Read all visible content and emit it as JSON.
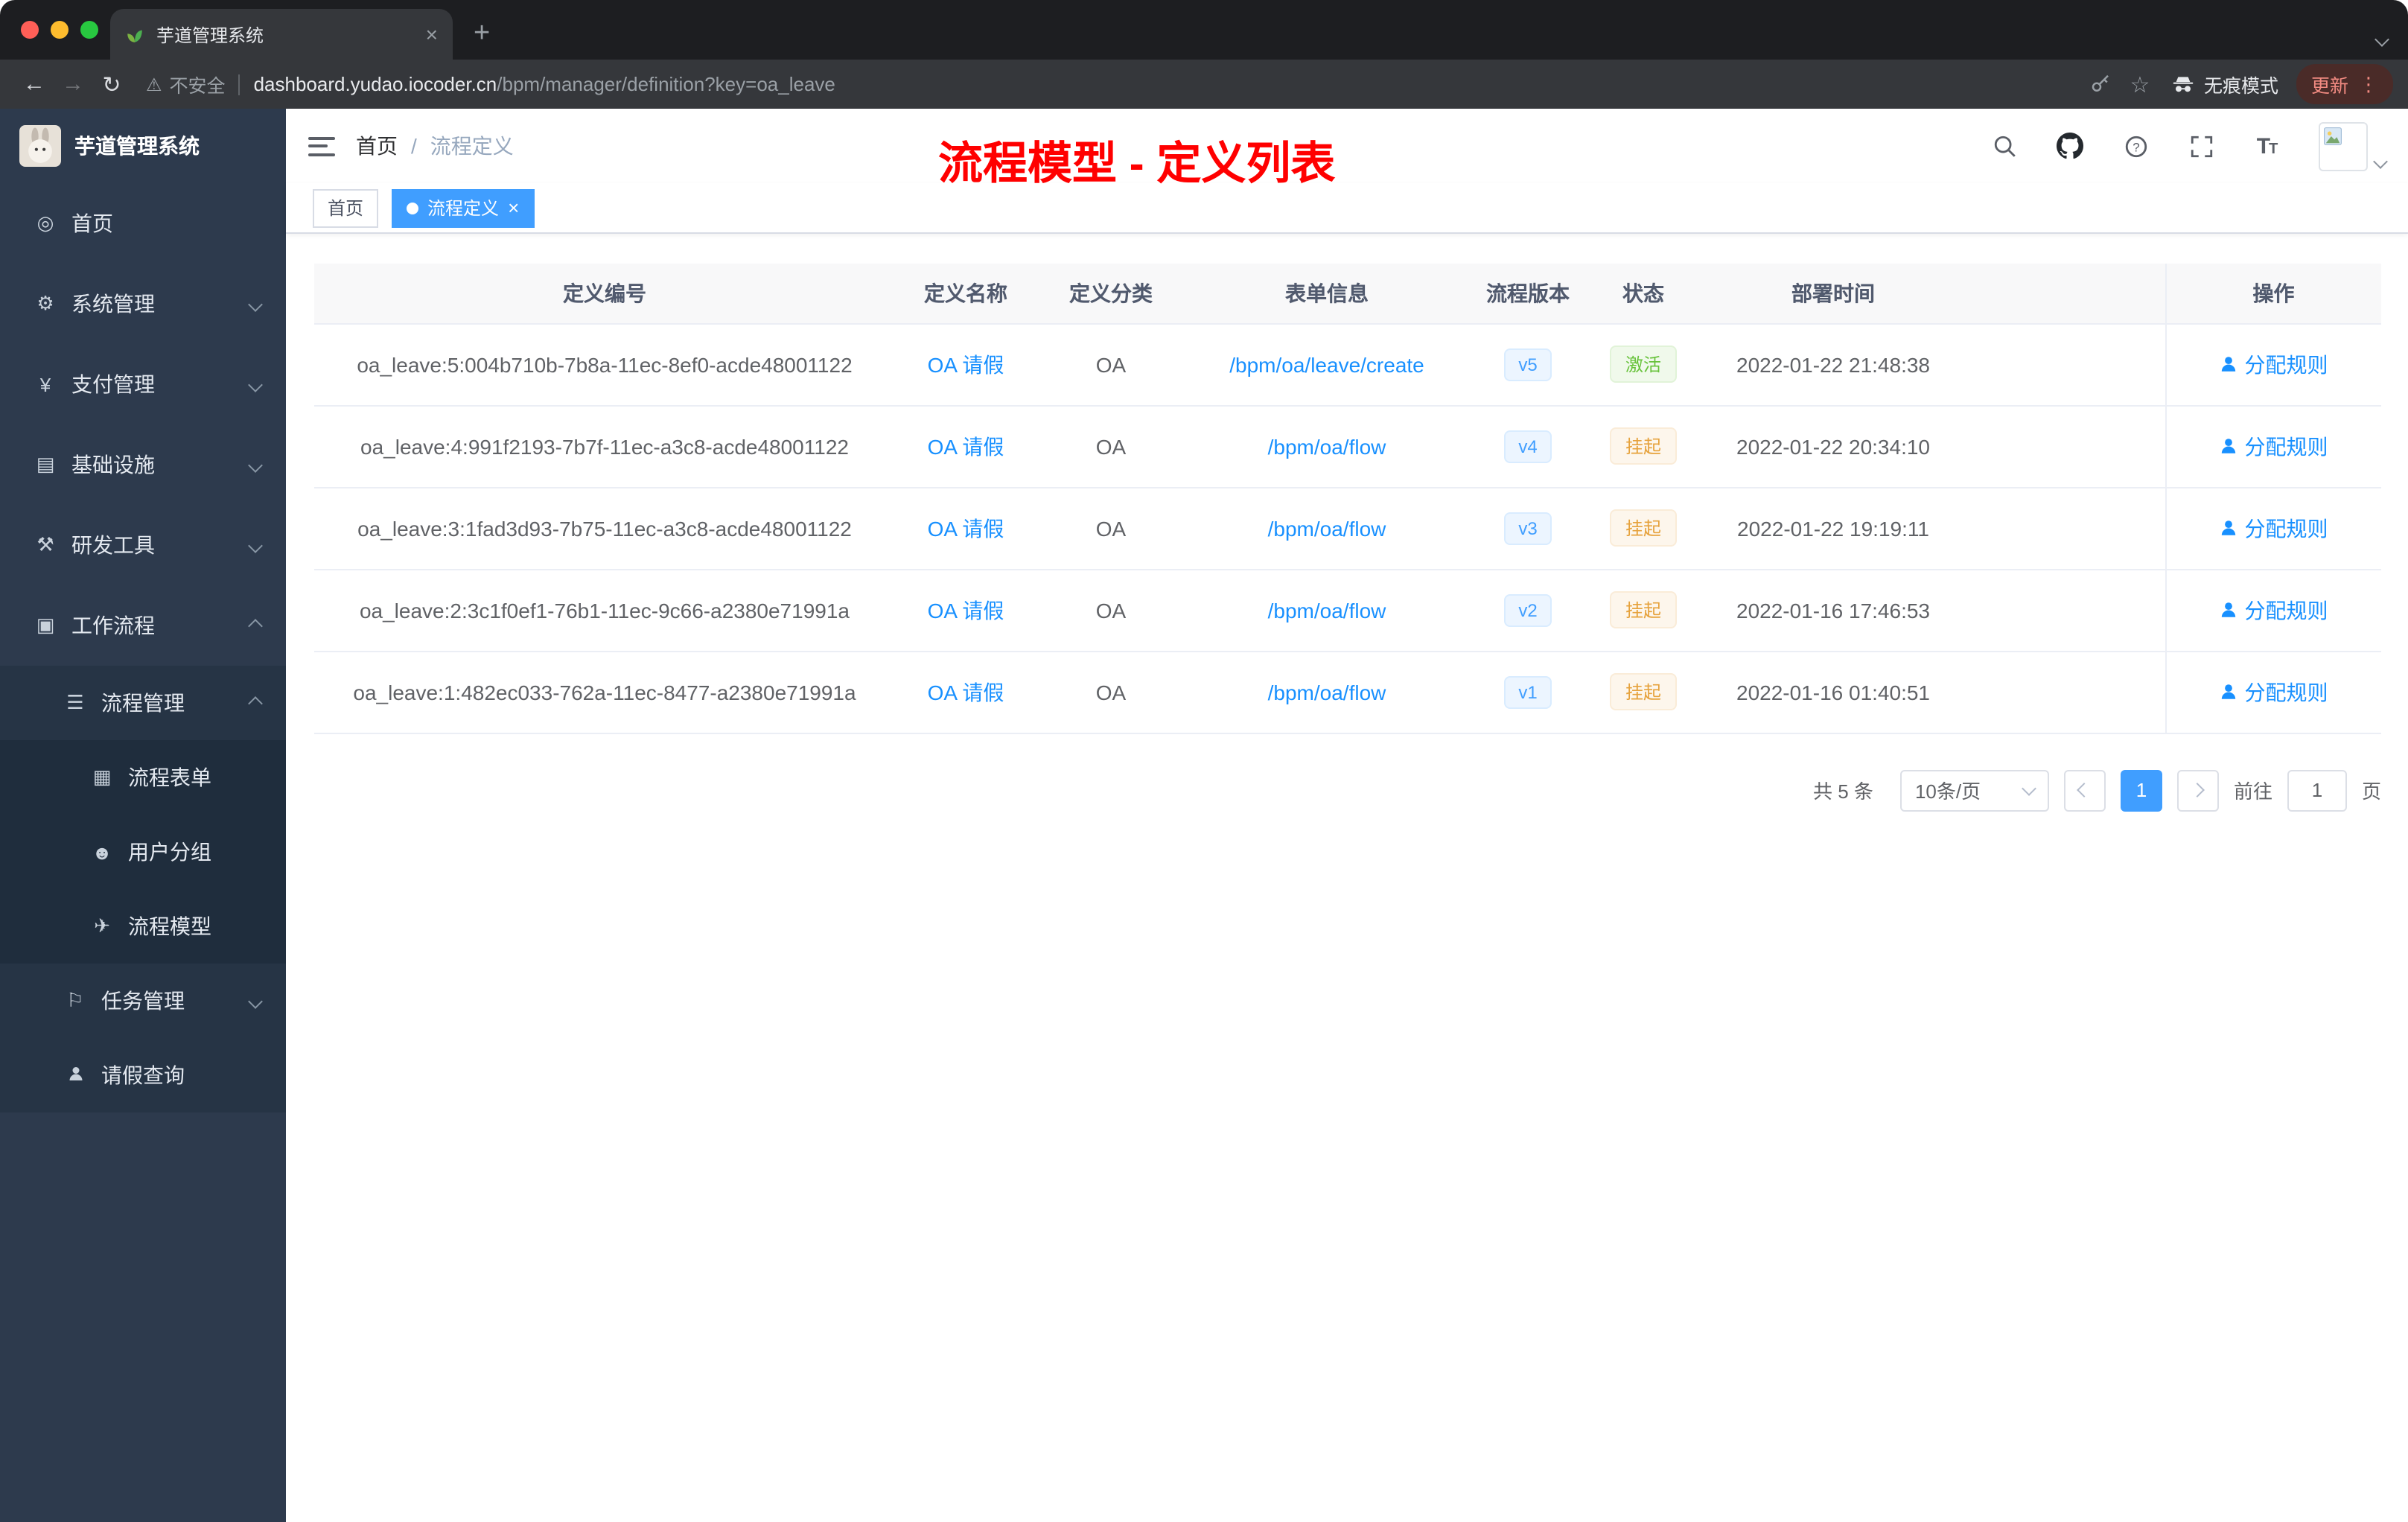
{
  "colors": {
    "accent": "#409eff",
    "link": "#1890ff",
    "success": "#67c23a",
    "warning": "#e6a23c",
    "annotation_red": "#ff0000",
    "sidebar_bg": "#2d3a4d"
  },
  "browser": {
    "tab_title": "芋道管理系统",
    "close_tab": "×",
    "new_tab": "+",
    "not_secure": "不安全",
    "warning_glyph": "⚠",
    "url_host": "dashboard.yudao.iocoder.cn",
    "url_path": "/bpm/manager/definition?key=oa_leave",
    "incognito_label": "无痕模式",
    "update_label": "更新",
    "menu_dots": "⋮"
  },
  "sidebar": {
    "app_title": "芋道管理系统",
    "items": [
      {
        "label": "首页"
      },
      {
        "label": "系统管理"
      },
      {
        "label": "支付管理"
      },
      {
        "label": "基础设施"
      },
      {
        "label": "研发工具"
      },
      {
        "label": "工作流程"
      },
      {
        "label": "流程管理"
      },
      {
        "label": "流程表单"
      },
      {
        "label": "用户分组"
      },
      {
        "label": "流程模型"
      },
      {
        "label": "任务管理"
      },
      {
        "label": "请假查询"
      }
    ]
  },
  "navbar": {
    "breadcrumb_home": "首页",
    "breadcrumb_sep": "/",
    "breadcrumb_current": "流程定义"
  },
  "annotation": {
    "text": "流程模型 - 定义列表"
  },
  "tags_view": {
    "home": "首页",
    "active": "流程定义",
    "close": "×"
  },
  "table": {
    "headers": [
      "定义编号",
      "定义名称",
      "定义分类",
      "表单信息",
      "流程版本",
      "状态",
      "部署时间",
      "操作"
    ],
    "rows": [
      {
        "id": "oa_leave:5:004b710b-7b8a-11ec-8ef0-acde48001122",
        "name": "OA 请假",
        "category": "OA",
        "form": "/bpm/oa/leave/create",
        "version": "v5",
        "status": "激活",
        "status_type": "success",
        "time": "2022-01-22 21:48:38",
        "action": "分配规则"
      },
      {
        "id": "oa_leave:4:991f2193-7b7f-11ec-a3c8-acde48001122",
        "name": "OA 请假",
        "category": "OA",
        "form": "/bpm/oa/flow",
        "version": "v4",
        "status": "挂起",
        "status_type": "warning",
        "time": "2022-01-22 20:34:10",
        "action": "分配规则"
      },
      {
        "id": "oa_leave:3:1fad3d93-7b75-11ec-a3c8-acde48001122",
        "name": "OA 请假",
        "category": "OA",
        "form": "/bpm/oa/flow",
        "version": "v3",
        "status": "挂起",
        "status_type": "warning",
        "time": "2022-01-22 19:19:11",
        "action": "分配规则"
      },
      {
        "id": "oa_leave:2:3c1f0ef1-76b1-11ec-9c66-a2380e71991a",
        "name": "OA 请假",
        "category": "OA",
        "form": "/bpm/oa/flow",
        "version": "v2",
        "status": "挂起",
        "status_type": "warning",
        "time": "2022-01-16 17:46:53",
        "action": "分配规则"
      },
      {
        "id": "oa_leave:1:482ec033-762a-11ec-8477-a2380e71991a",
        "name": "OA 请假",
        "category": "OA",
        "form": "/bpm/oa/flow",
        "version": "v1",
        "status": "挂起",
        "status_type": "warning",
        "time": "2022-01-16 01:40:51",
        "action": "分配规则"
      }
    ]
  },
  "pagination": {
    "total": "共 5 条",
    "page_size": "10条/页",
    "current_page": "1",
    "goto_label": "前往",
    "goto_value": "1",
    "goto_unit": "页"
  }
}
